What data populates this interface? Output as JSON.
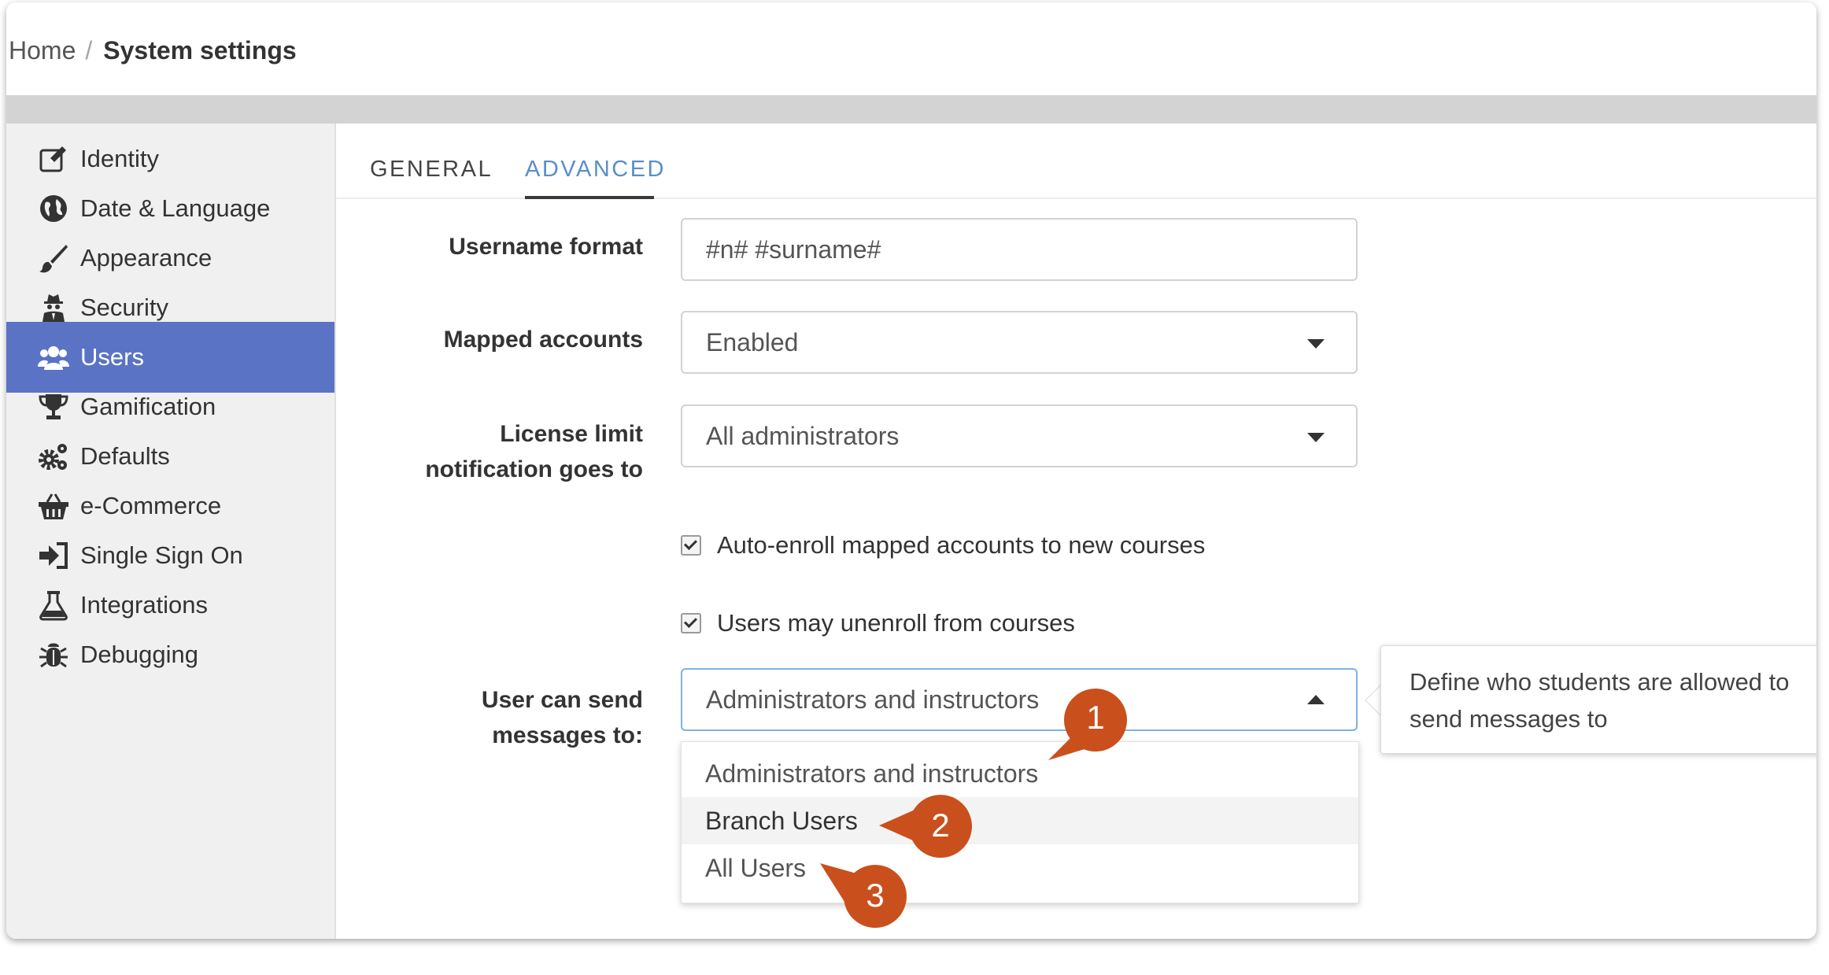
{
  "breadcrumb": {
    "home": "Home",
    "separator": "/",
    "current": "System settings"
  },
  "sidebar": {
    "active_color": "#5a73c4",
    "items": [
      {
        "label": "Identity",
        "icon": "edit-icon"
      },
      {
        "label": "Date & Language",
        "icon": "globe-icon"
      },
      {
        "label": "Appearance",
        "icon": "brush-icon"
      },
      {
        "label": "Security",
        "icon": "user-secret-icon"
      },
      {
        "label": "Users",
        "icon": "users-icon",
        "active": true
      },
      {
        "label": "Gamification",
        "icon": "trophy-icon"
      },
      {
        "label": "Defaults",
        "icon": "gears-icon"
      },
      {
        "label": "e-Commerce",
        "icon": "basket-icon"
      },
      {
        "label": "Single Sign On",
        "icon": "sign-in-icon"
      },
      {
        "label": "Integrations",
        "icon": "flask-icon"
      },
      {
        "label": "Debugging",
        "icon": "bug-icon"
      }
    ]
  },
  "tabs": [
    {
      "label": "GENERAL",
      "active": false
    },
    {
      "label": "ADVANCED",
      "active": true
    }
  ],
  "form": {
    "username_format": {
      "label": "Username format",
      "value": "#n# #surname#"
    },
    "mapped_accounts": {
      "label": "Mapped accounts",
      "value": "Enabled"
    },
    "license_limit": {
      "label_line1": "License limit",
      "label_line2": "notification goes to",
      "value": "All administrators"
    },
    "auto_enroll": {
      "label": "Auto-enroll mapped accounts to new courses",
      "checked": true
    },
    "unenroll": {
      "label": "Users may unenroll from courses",
      "checked": true
    },
    "send_messages": {
      "label_line1": "User can send",
      "label_line2": "messages to:",
      "value": "Administrators and instructors",
      "options": [
        "Administrators and instructors",
        "Branch Users",
        "All Users"
      ]
    }
  },
  "tooltip": {
    "line1": "Define who students are allowed to",
    "line2": "send messages to"
  },
  "callouts": {
    "color": "#c9501c",
    "numbers": [
      "1",
      "2",
      "3"
    ]
  }
}
